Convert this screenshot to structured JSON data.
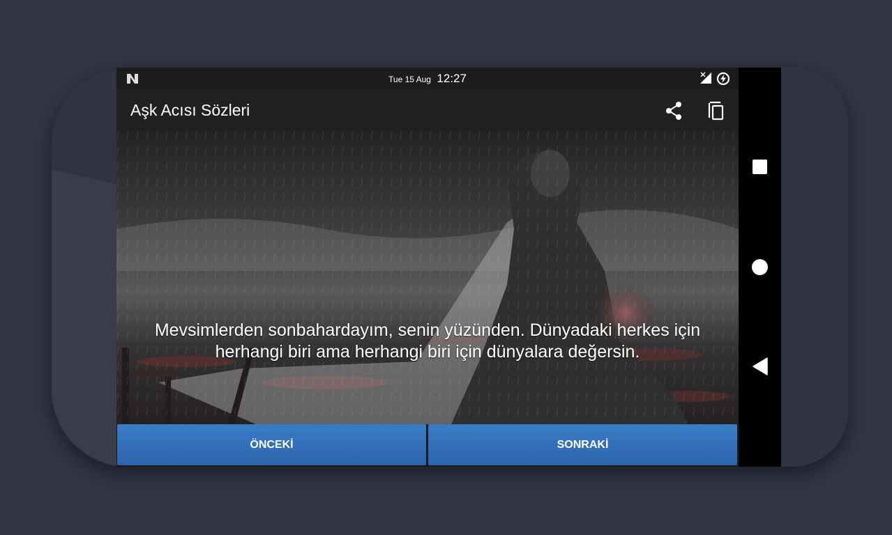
{
  "status_bar": {
    "date": "Tue 15 Aug",
    "time": "12:27",
    "left_icon": "notification-n-icon",
    "right_icons": [
      "signal-icon",
      "battery-charging-icon"
    ]
  },
  "app_bar": {
    "title": "Aşk Acısı Sözleri",
    "actions": [
      "share-icon",
      "copy-icon"
    ]
  },
  "quote": {
    "text": "Mevsimlerden sonbahardayım, senin yüzünden. Dünyadaki herkes için herhangi biri ama herhangi biri için dünyalara değersin."
  },
  "buttons": {
    "previous": "ÖNCEKİ",
    "next": "SONRAKİ"
  },
  "nav_bar": {
    "items": [
      "recents-icon",
      "home-icon",
      "back-icon"
    ]
  },
  "colors": {
    "background": "#323645",
    "app_bar": "#212121",
    "button": "#3371bb"
  }
}
